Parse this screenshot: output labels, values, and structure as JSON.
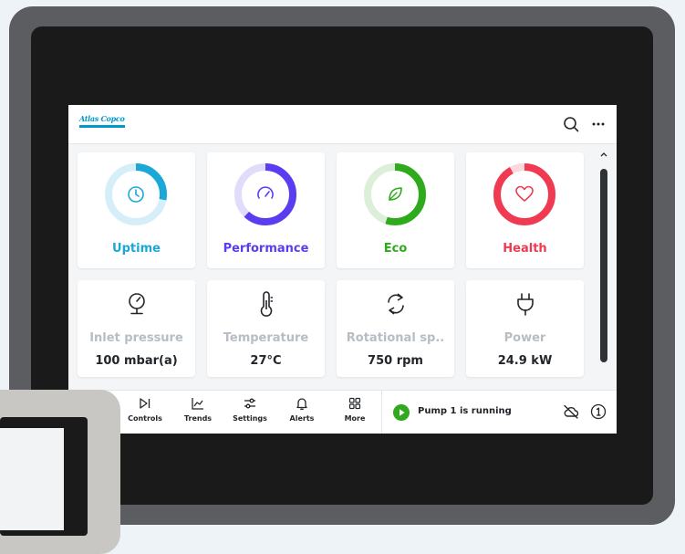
{
  "app": {
    "brand": "Atlas Copco",
    "colors": {
      "accent": "#0099cc",
      "performance": "#5b3cf0",
      "eco": "#2faa1d",
      "health": "#f03a52"
    }
  },
  "header": {
    "search_icon": "search-icon",
    "more_icon": "more-horizontal-icon"
  },
  "kpis": [
    {
      "label": "Uptime",
      "icon": "clock-icon",
      "color": "#1ba7d8",
      "track": "#d6eef8",
      "progress": 0.28
    },
    {
      "label": "Performance",
      "icon": "gauge-icon",
      "color": "#5b3cf0",
      "track": "#e2dcfb",
      "progress": 0.62
    },
    {
      "label": "Eco",
      "icon": "leaf-icon",
      "color": "#2faa1d",
      "track": "#dcefd8",
      "progress": 0.55
    },
    {
      "label": "Health",
      "icon": "heart-icon",
      "color": "#f03a52",
      "track": "#fcd7dc",
      "progress": 0.92
    }
  ],
  "metrics": [
    {
      "label": "Inlet pressure",
      "value": "100 mbar(a)",
      "icon": "pressure-gauge-icon"
    },
    {
      "label": "Temperature",
      "value": "27°C",
      "icon": "thermometer-icon"
    },
    {
      "label": "Rotational sp..",
      "value": "750 rpm",
      "icon": "rotation-icon"
    },
    {
      "label": "Power",
      "value": "24.9 kW",
      "icon": "plug-icon"
    }
  ],
  "nav": [
    {
      "label": "Controls",
      "icon": "play-pause-icon"
    },
    {
      "label": "Trends",
      "icon": "trend-chart-icon"
    },
    {
      "label": "Settings",
      "icon": "sliders-icon"
    },
    {
      "label": "Alerts",
      "icon": "bell-icon"
    },
    {
      "label": "More",
      "icon": "grid-icon"
    }
  ],
  "status": {
    "text": "Pump 1 is running",
    "cloud_icon": "cloud-off-icon",
    "badge_icon": "badge-1-icon"
  }
}
